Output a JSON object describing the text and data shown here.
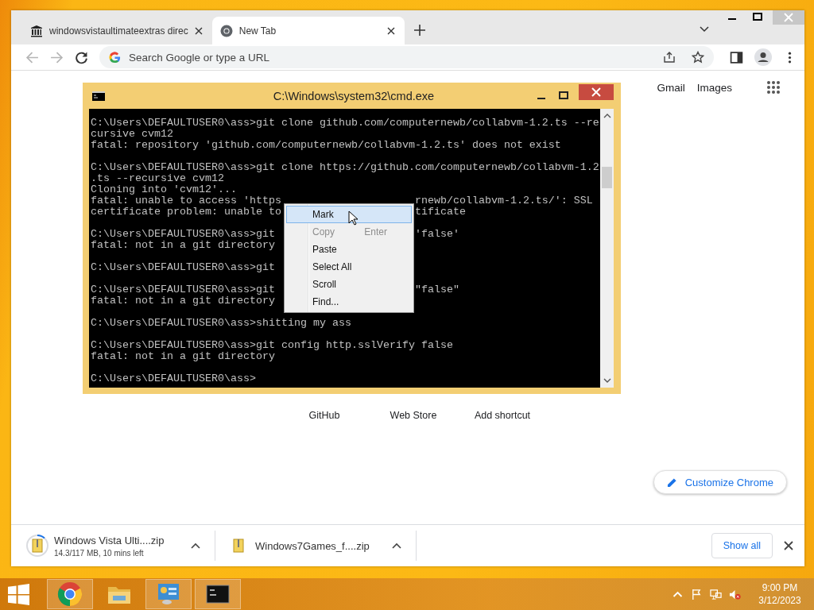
{
  "browser": {
    "tabs": [
      {
        "title": "windowsvistaultimateextras direc",
        "kind": "archive",
        "selected": false
      },
      {
        "title": "New Tab",
        "kind": "chrome",
        "selected": true
      }
    ],
    "omnibox": {
      "placeholder": "Search Google or type a URL"
    },
    "header_links": [
      "Gmail",
      "Images"
    ],
    "shortcuts": [
      "GitHub",
      "Web Store",
      "Add shortcut"
    ],
    "customize_button": "Customize Chrome",
    "downloads": [
      {
        "name": "Windows Vista Ulti....zip",
        "status": "14.3/117 MB, 10 mins left",
        "level": 0.12
      },
      {
        "name": "Windows7Games_f....zip"
      }
    ],
    "show_all": "Show all"
  },
  "console": {
    "title": "C:\\Windows\\system32\\cmd.exe",
    "blocks": [
      [
        {
          "text": "C:\\Users\\DEFAULTUSER0\\ass>git clone github.com/computernewb/collabvm-1.2.ts --re"
        },
        {
          "text": "cursive cvm12"
        },
        {
          "text": "fatal: repository 'github.com/computernewb/collabvm-1.2.ts' does not exist"
        }
      ],
      [
        {
          "text": "C:\\Users\\DEFAULTUSER0\\ass>git clone https://github.com/computernewb/collabvm-1.2"
        },
        {
          "text": ".ts --recursive cvm12"
        },
        {
          "text": "Cloning into 'cvm12'..."
        },
        {
          "text": "fatal: unable to access 'https",
          "tail": "rnewb/collabvm-1.2.ts/': SSL"
        },
        {
          "text": "certificate problem: unable to",
          "tail": "tificate"
        }
      ],
      [
        {
          "text": "C:\\Users\\DEFAULTUSER0\\ass>git",
          "tail": "'false'"
        },
        {
          "text": "fatal: not in a git directory"
        }
      ],
      [
        {
          "text": "C:\\Users\\DEFAULTUSER0\\ass>git"
        }
      ],
      [
        {
          "text": "C:\\Users\\DEFAULTUSER0\\ass>git",
          "tail": "\"false\""
        },
        {
          "text": "fatal: not in a git directory"
        }
      ],
      [
        {
          "text": "C:\\Users\\DEFAULTUSER0\\ass>shitting my ass"
        }
      ],
      [
        {
          "text": "C:\\Users\\DEFAULTUSER0\\ass>git config http.sslVerify false"
        },
        {
          "text": "fatal: not in a git directory"
        }
      ],
      [
        {
          "text": "C:\\Users\\DEFAULTUSER0\\ass>"
        }
      ]
    ]
  },
  "context_menu": {
    "items": [
      {
        "label": "Mark",
        "selected": true,
        "disabled": false
      },
      {
        "label": "Copy",
        "shortcut": "Enter",
        "selected": false,
        "disabled": true
      },
      {
        "label": "Paste",
        "selected": false,
        "disabled": false
      },
      {
        "label": "Select All",
        "selected": false,
        "disabled": false
      },
      {
        "label": "Scroll",
        "selected": false,
        "disabled": false
      },
      {
        "label": "Find...",
        "selected": false,
        "disabled": false
      }
    ]
  },
  "taskbar": {
    "apps": [
      {
        "kind": "chrome",
        "running": true
      },
      {
        "kind": "explorer",
        "running": false
      },
      {
        "kind": "control-panel",
        "running": true
      },
      {
        "kind": "console",
        "running": true
      }
    ],
    "clock": {
      "time": "9:00 PM",
      "date": "3/12/2023"
    }
  }
}
